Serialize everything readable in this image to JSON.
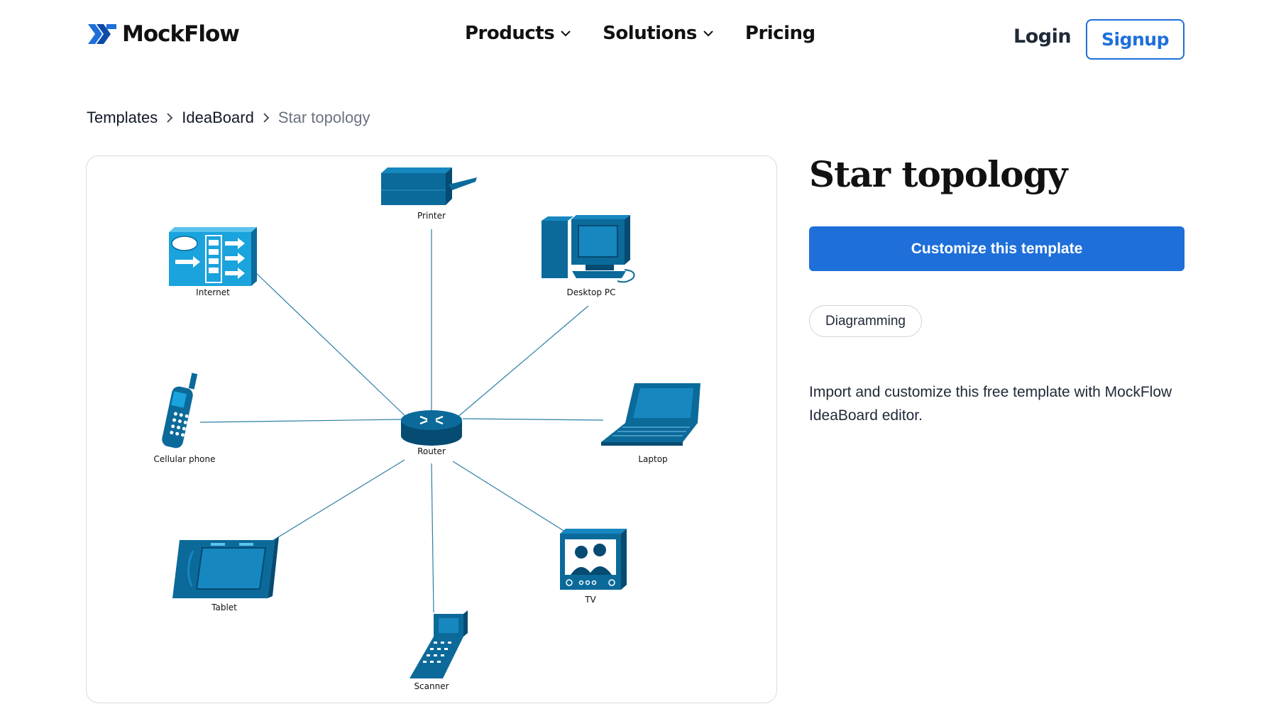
{
  "header": {
    "logo_text": "MockFlow",
    "nav": [
      {
        "label": "Products",
        "has_dropdown": true
      },
      {
        "label": "Solutions",
        "has_dropdown": true
      },
      {
        "label": "Pricing",
        "has_dropdown": false
      }
    ],
    "login_label": "Login",
    "signup_label": "Signup"
  },
  "breadcrumb": [
    "Templates",
    "IdeaBoard",
    "Star topology"
  ],
  "diagram": {
    "hub": "Router",
    "nodes": [
      "Printer",
      "Desktop PC",
      "Internet",
      "Cellular phone",
      "Laptop",
      "Tablet",
      "TV",
      "Scanner"
    ]
  },
  "template": {
    "title": "Star topology",
    "cta_label": "Customize this template",
    "tag": "Diagramming",
    "description": "Import and customize this free template with MockFlow IdeaBoard editor."
  },
  "colors": {
    "accent": "#1e6fd9",
    "device_fill": "#0b6a9a",
    "device_dark": "#054b72",
    "internet_fill": "#1aa3dd",
    "line": "#2d7ea3"
  }
}
